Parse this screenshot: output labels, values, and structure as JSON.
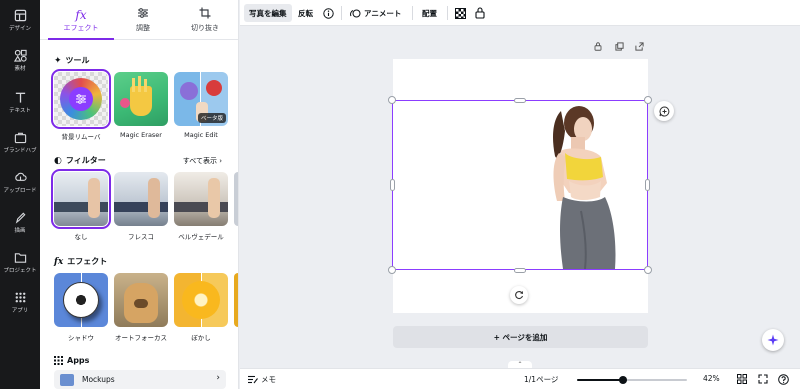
{
  "rail": {
    "items": [
      {
        "label": "デザイン",
        "icon": "design-icon"
      },
      {
        "label": "素材",
        "icon": "elements-icon"
      },
      {
        "label": "テキスト",
        "icon": "text-icon"
      },
      {
        "label": "ブランドハブ",
        "icon": "brand-hub-icon"
      },
      {
        "label": "アップロード",
        "icon": "upload-icon"
      },
      {
        "label": "描画",
        "icon": "draw-icon"
      },
      {
        "label": "プロジェクト",
        "icon": "projects-icon"
      },
      {
        "label": "アプリ",
        "icon": "apps-icon"
      }
    ]
  },
  "panel": {
    "tabs": [
      {
        "label": "エフェクト",
        "icon": "fx-icon",
        "active": true
      },
      {
        "label": "調整",
        "icon": "adjust-icon",
        "active": false
      },
      {
        "label": "切り抜き",
        "icon": "crop-icon",
        "active": false
      }
    ],
    "tools": {
      "title": "ツール",
      "items": [
        {
          "label": "背景リムーバ"
        },
        {
          "label": "Magic Eraser"
        },
        {
          "label": "Magic Edit",
          "badge": "ベータ版"
        }
      ]
    },
    "filters": {
      "title": "フィルター",
      "see_all": "すべて表示",
      "items": [
        {
          "label": "なし"
        },
        {
          "label": "フレスコ"
        },
        {
          "label": "ベルヴェデール"
        }
      ]
    },
    "effects": {
      "title": "エフェクト",
      "items": [
        {
          "label": "シャドウ"
        },
        {
          "label": "オートフォーカス"
        },
        {
          "label": "ぼかし"
        }
      ]
    },
    "apps": {
      "title": "Apps",
      "first_item": "Mockups"
    }
  },
  "toolbar": {
    "edit_photo": "写真を編集",
    "flip": "反転",
    "animate": "アニメート",
    "position": "配置"
  },
  "canvas": {
    "add_page": "+ ページを追加"
  },
  "bottombar": {
    "notes": "メモ",
    "page_indicator": "1/1ページ",
    "zoom": "42%",
    "zoom_level": 0.42
  },
  "colors": {
    "accent": "#7d2ae8",
    "selection": "#8b3dff",
    "rail_bg": "#18191b"
  }
}
